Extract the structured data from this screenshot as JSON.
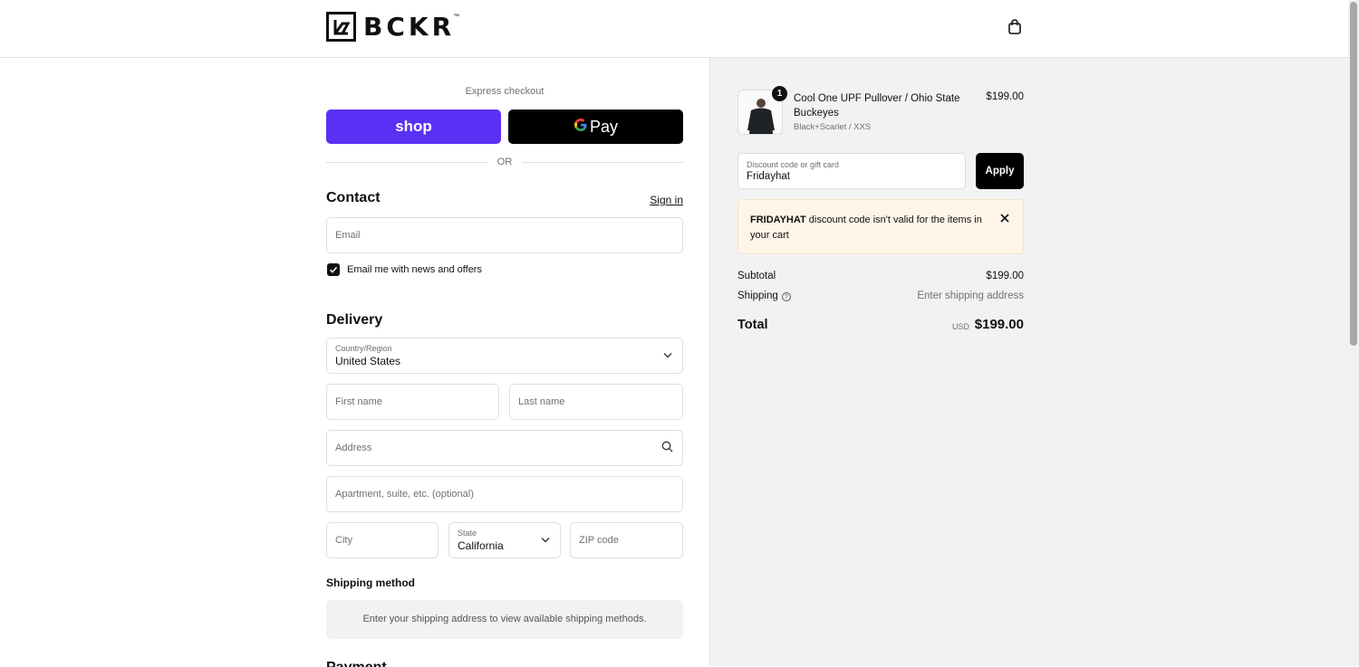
{
  "brand": {
    "name": "BCKR",
    "tm": "™"
  },
  "express": {
    "label": "Express checkout",
    "shop_label": "shop",
    "gpay_label": "Pay",
    "gpay_g": "G",
    "or_label": "OR",
    "shop_color": "#5a31f4"
  },
  "contact": {
    "title": "Contact",
    "sign_in": "Sign in",
    "email_placeholder": "Email",
    "news_checkbox_label": "Email me with news and offers",
    "news_checked": true
  },
  "delivery": {
    "title": "Delivery",
    "country_label": "Country/Region",
    "country_value": "United States",
    "first_name_placeholder": "First name",
    "last_name_placeholder": "Last name",
    "address_placeholder": "Address",
    "apartment_placeholder": "Apartment, suite, etc. (optional)",
    "city_placeholder": "City",
    "state_label": "State",
    "state_value": "California",
    "zip_placeholder": "ZIP code"
  },
  "shipping_method": {
    "title": "Shipping method",
    "info": "Enter your shipping address to view available shipping methods."
  },
  "payment": {
    "title": "Payment"
  },
  "cart": {
    "item": {
      "quantity": "1",
      "name": "Cool One UPF Pullover / Ohio State Buckeyes",
      "variant": "Black+Scarlet / XXS",
      "price": "$199.00"
    },
    "discount": {
      "label": "Discount code or gift card",
      "value": "Fridayhat",
      "apply_label": "Apply"
    },
    "error": {
      "code": "FRIDAYHAT",
      "message": " discount code isn't valid for the items in your cart",
      "close_icon": "×"
    },
    "subtotal_label": "Subtotal",
    "subtotal_value": "$199.00",
    "shipping_label": "Shipping",
    "shipping_help_icon": "?",
    "shipping_value": "Enter shipping address",
    "total_label": "Total",
    "total_currency": "USD",
    "total_value": "$199.00"
  }
}
